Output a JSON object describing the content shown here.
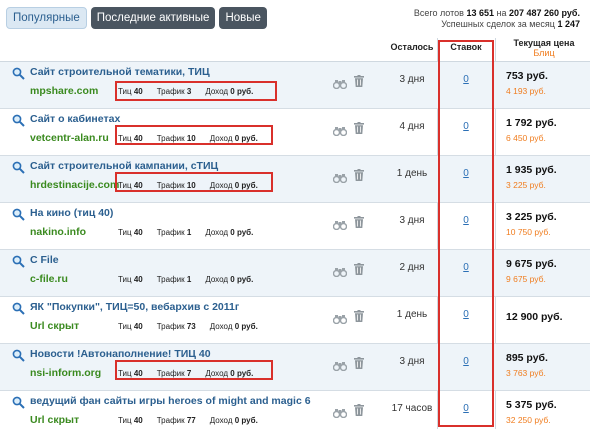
{
  "tabs": [
    {
      "label": "Популярные",
      "active": true
    },
    {
      "label": "Последние активные",
      "active": false
    },
    {
      "label": "Новые",
      "active": false
    }
  ],
  "stats": {
    "line1_prefix": "Всего лотов",
    "lots": "13 651",
    "line1_mid": "на",
    "lots_sum": "207 487 260 руб.",
    "line2_prefix": "Успешных сделок за месяц",
    "deals": "1 247"
  },
  "columns": {
    "left": "Осталось",
    "bids": "Ставок",
    "price": "Текущая цена",
    "price_sub": "Блиц"
  },
  "meta_labels": {
    "tic": "Тиц",
    "traffic": "Трафик",
    "income": "Доход"
  },
  "rows": [
    {
      "title": "Сайт строительной тематики, ТИЦ",
      "domain": "mpshare.com",
      "tic": "40",
      "traffic": "3",
      "income": "0 руб.",
      "left": "3 дня",
      "bids": "0",
      "price": "753 руб.",
      "blitz": "4 193 руб."
    },
    {
      "title": "Сайт о кабинетах",
      "domain": "vetcentr-alan.ru",
      "tic": "40",
      "traffic": "10",
      "income": "0 руб.",
      "left": "4 дня",
      "bids": "0",
      "price": "1 792 руб.",
      "blitz": "6 450 руб."
    },
    {
      "title": "Сайт строительной кампании, сТИЦ",
      "domain": "hrdestinacije.com",
      "tic": "40",
      "traffic": "10",
      "income": "0 руб.",
      "left": "1 день",
      "bids": "0",
      "price": "1 935 руб.",
      "blitz": "3 225 руб."
    },
    {
      "title": "На кино (тиц 40)",
      "domain": "nakino.info",
      "tic": "40",
      "traffic": "1",
      "income": "0 руб.",
      "left": "3 дня",
      "bids": "0",
      "price": "3 225 руб.",
      "blitz": "10 750 руб."
    },
    {
      "title": "C File",
      "domain": "c-file.ru",
      "tic": "40",
      "traffic": "1",
      "income": "0 руб.",
      "left": "2 дня",
      "bids": "0",
      "price": "9 675 руб.",
      "blitz": "9 675 руб."
    },
    {
      "title": "ЯК \"Покупки\", ТИЦ=50, вебархив с 2011г",
      "domain": "Url скрыт",
      "tic": "40",
      "traffic": "73",
      "income": "0 руб.",
      "left": "1 день",
      "bids": "0",
      "price": "12 900 руб.",
      "blitz": ""
    },
    {
      "title": "Новости !Автонаполнение! ТИЦ 40",
      "domain": "nsi-inform.org",
      "tic": "40",
      "traffic": "7",
      "income": "0 руб.",
      "left": "3 дня",
      "bids": "0",
      "price": "895 руб.",
      "blitz": "3 763 руб."
    },
    {
      "title": "ведущий фан сайты игры heroes of might and magic 6",
      "domain": "Url скрыт",
      "tic": "40",
      "traffic": "77",
      "income": "0 руб.",
      "left": "17 часов",
      "bids": "0",
      "price": "5 375 руб.",
      "blitz": "32 250 руб."
    }
  ],
  "colors": {
    "accent": "#2b5f8f",
    "domain": "#3a8a1f",
    "blitz": "#f07d1f",
    "highlight": "#d9302b"
  },
  "icons": {
    "row_left": "magnifier-icon",
    "watch": "binoculars-icon",
    "delete": "trash-icon"
  }
}
